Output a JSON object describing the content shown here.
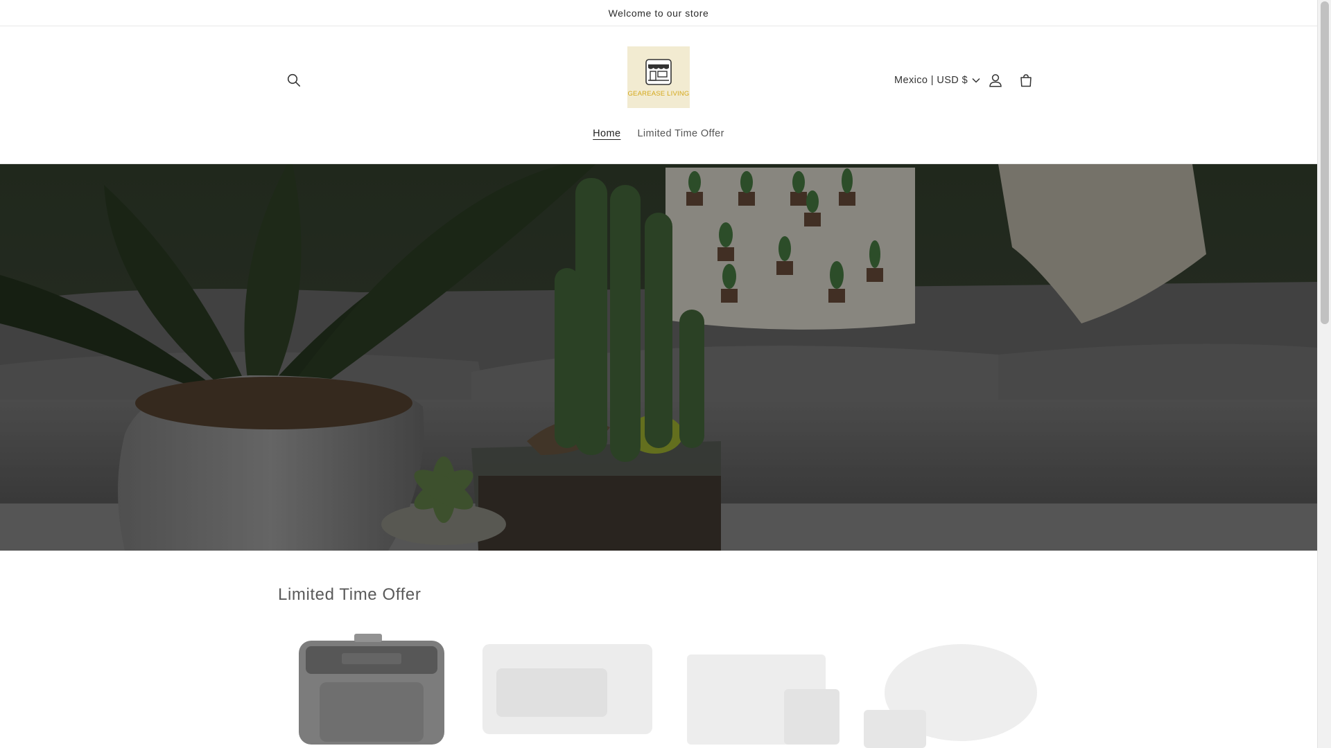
{
  "announcement": {
    "text": "Welcome to our store"
  },
  "header": {
    "logo": {
      "name": "GEAREASE LIVING",
      "background": "#f2ebd1",
      "accent": "#d4a81b"
    },
    "search_icon": "search-icon",
    "locale": {
      "label": "Mexico | USD $"
    },
    "account_icon": "user-icon",
    "cart_icon": "cart-icon"
  },
  "nav": {
    "items": [
      {
        "label": "Home",
        "active": true
      },
      {
        "label": "Limited Time Offer",
        "active": false
      }
    ]
  },
  "hero": {
    "image": "living-room-cactus-plants-photo",
    "overlay": "dark"
  },
  "featured": {
    "title": "Limited Time Offer",
    "products": [
      {
        "image": "air-fryer-photo"
      },
      {
        "image": "product-photo-2"
      },
      {
        "image": "product-photo-3"
      },
      {
        "image": "product-photo-4"
      }
    ]
  }
}
